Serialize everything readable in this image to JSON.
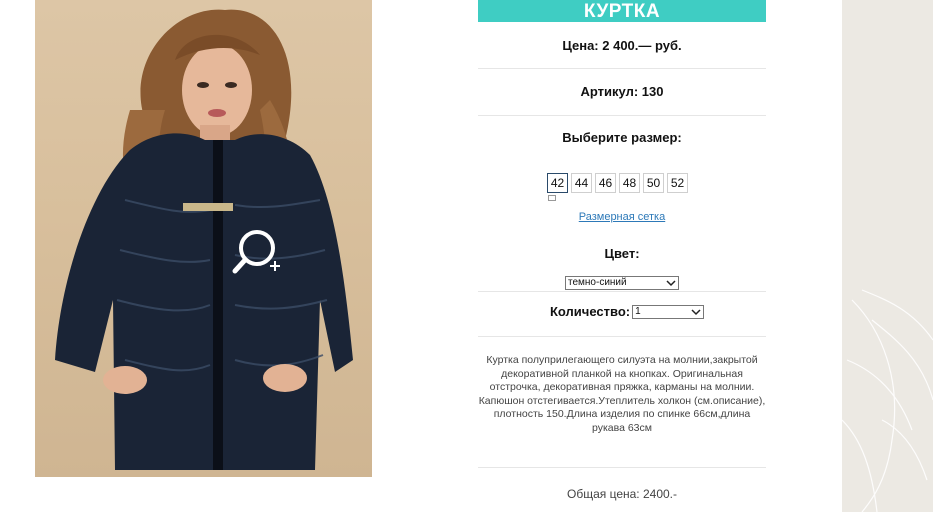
{
  "product": {
    "title": "КУРТКА",
    "price": "Цена: 2 400.— руб.",
    "article": "Артикул: 130",
    "size_heading": "Выберите размер:",
    "sizes": [
      "42",
      "44",
      "46",
      "48",
      "50",
      "52"
    ],
    "selected_size": "42",
    "size_chart_link": "Размерная сетка",
    "color_heading": "Цвет:",
    "color_value": "темно-синий",
    "quantity_label": "Количество:",
    "quantity_value": "1",
    "description": "Куртка полуприлегающего силуэта на молнии,закрытой декоративной планкой на кнопках. Оригинальная отстрочка, декоративная пряжка, карманы на молнии. Капюшон отстегивается.Утеплитель холкон (см.описание), плотность 150.Длина изделия по спинке 66см,длина рукава 63см",
    "total": "Общая цена: 2400.-"
  },
  "colors": {
    "accent": "#3fcdc3",
    "link": "#2d79b8",
    "jacket": "#1a2436"
  },
  "icons": {
    "zoom": "magnifier-plus-icon",
    "dropdown": "chevron-down-icon"
  }
}
